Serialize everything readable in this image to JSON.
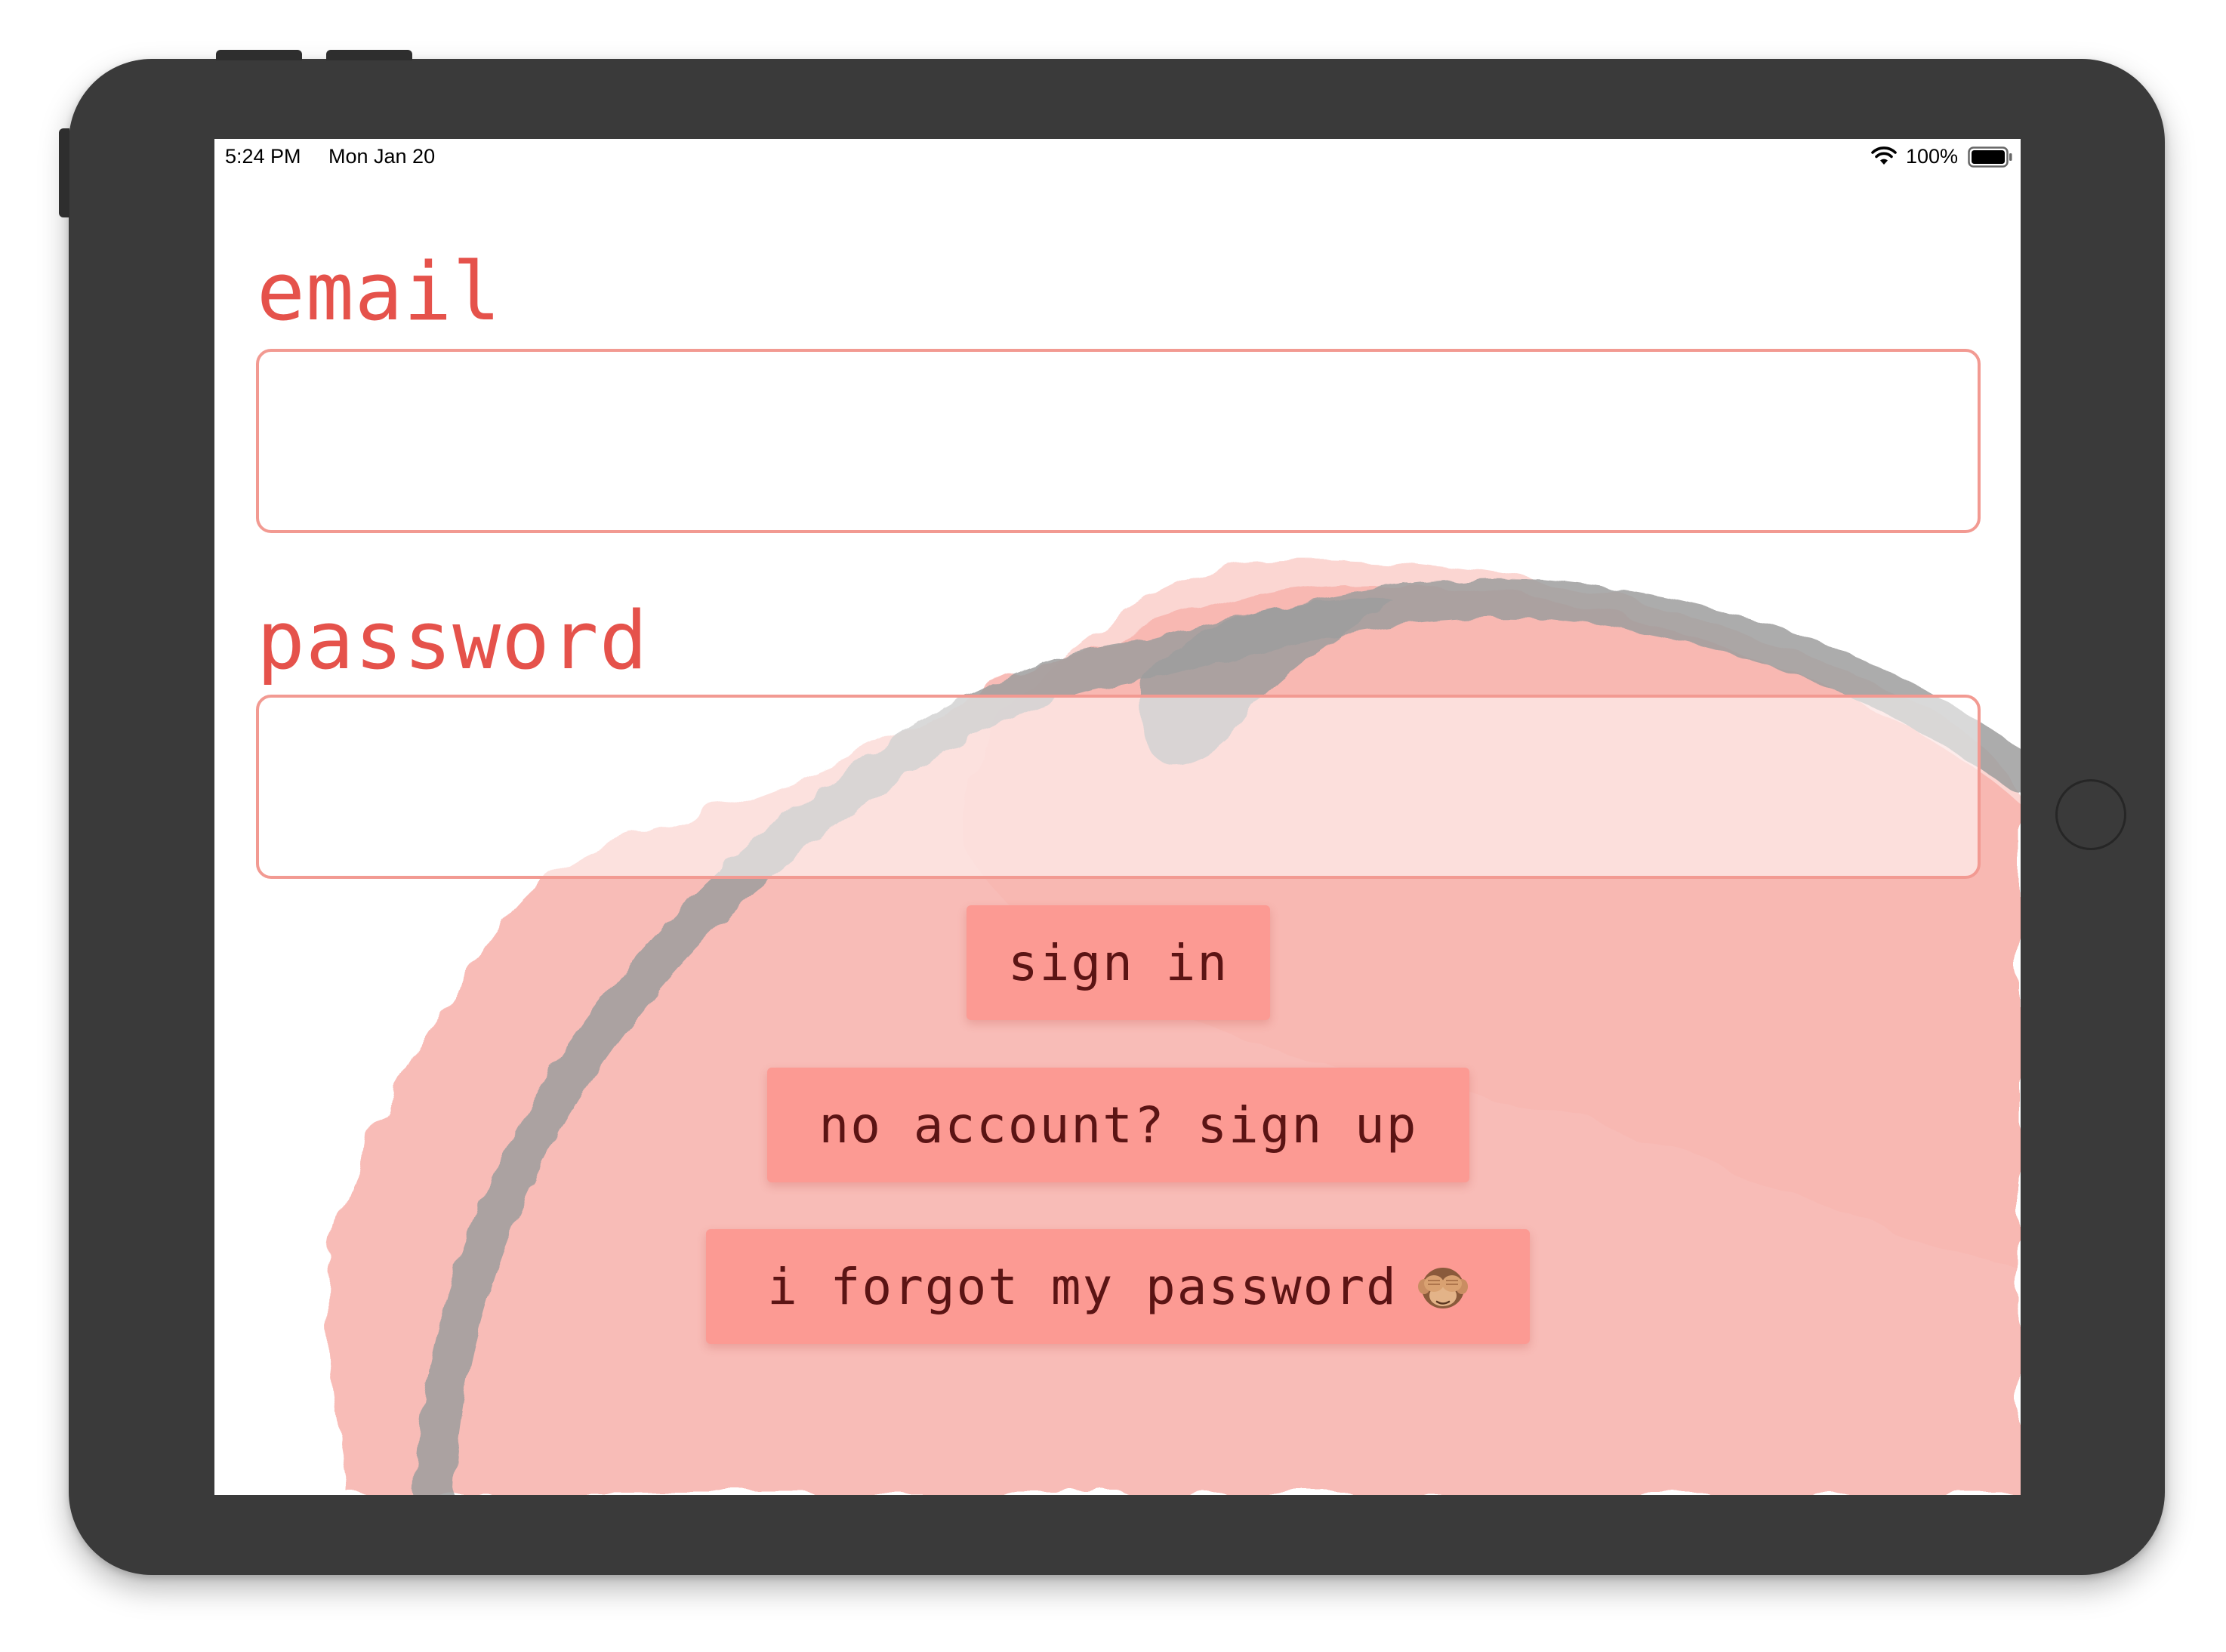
{
  "status_bar": {
    "time": "5:24 PM",
    "date": "Mon Jan 20",
    "battery": "100%",
    "icons": [
      "wifi-icon",
      "battery-icon"
    ]
  },
  "form": {
    "email_label": "email",
    "email_value": "",
    "password_label": "password",
    "password_value": ""
  },
  "buttons": {
    "sign_in": "sign in",
    "sign_up": "no account? sign up",
    "forgot": "i forgot my password",
    "forgot_icon": "see-no-evil-monkey-icon"
  },
  "colors": {
    "accent": "#e5524b",
    "field_border": "#f29a92",
    "button_bg": "#fc9a93",
    "button_text": "#5b1414",
    "device_frame": "#3a3a3a"
  }
}
